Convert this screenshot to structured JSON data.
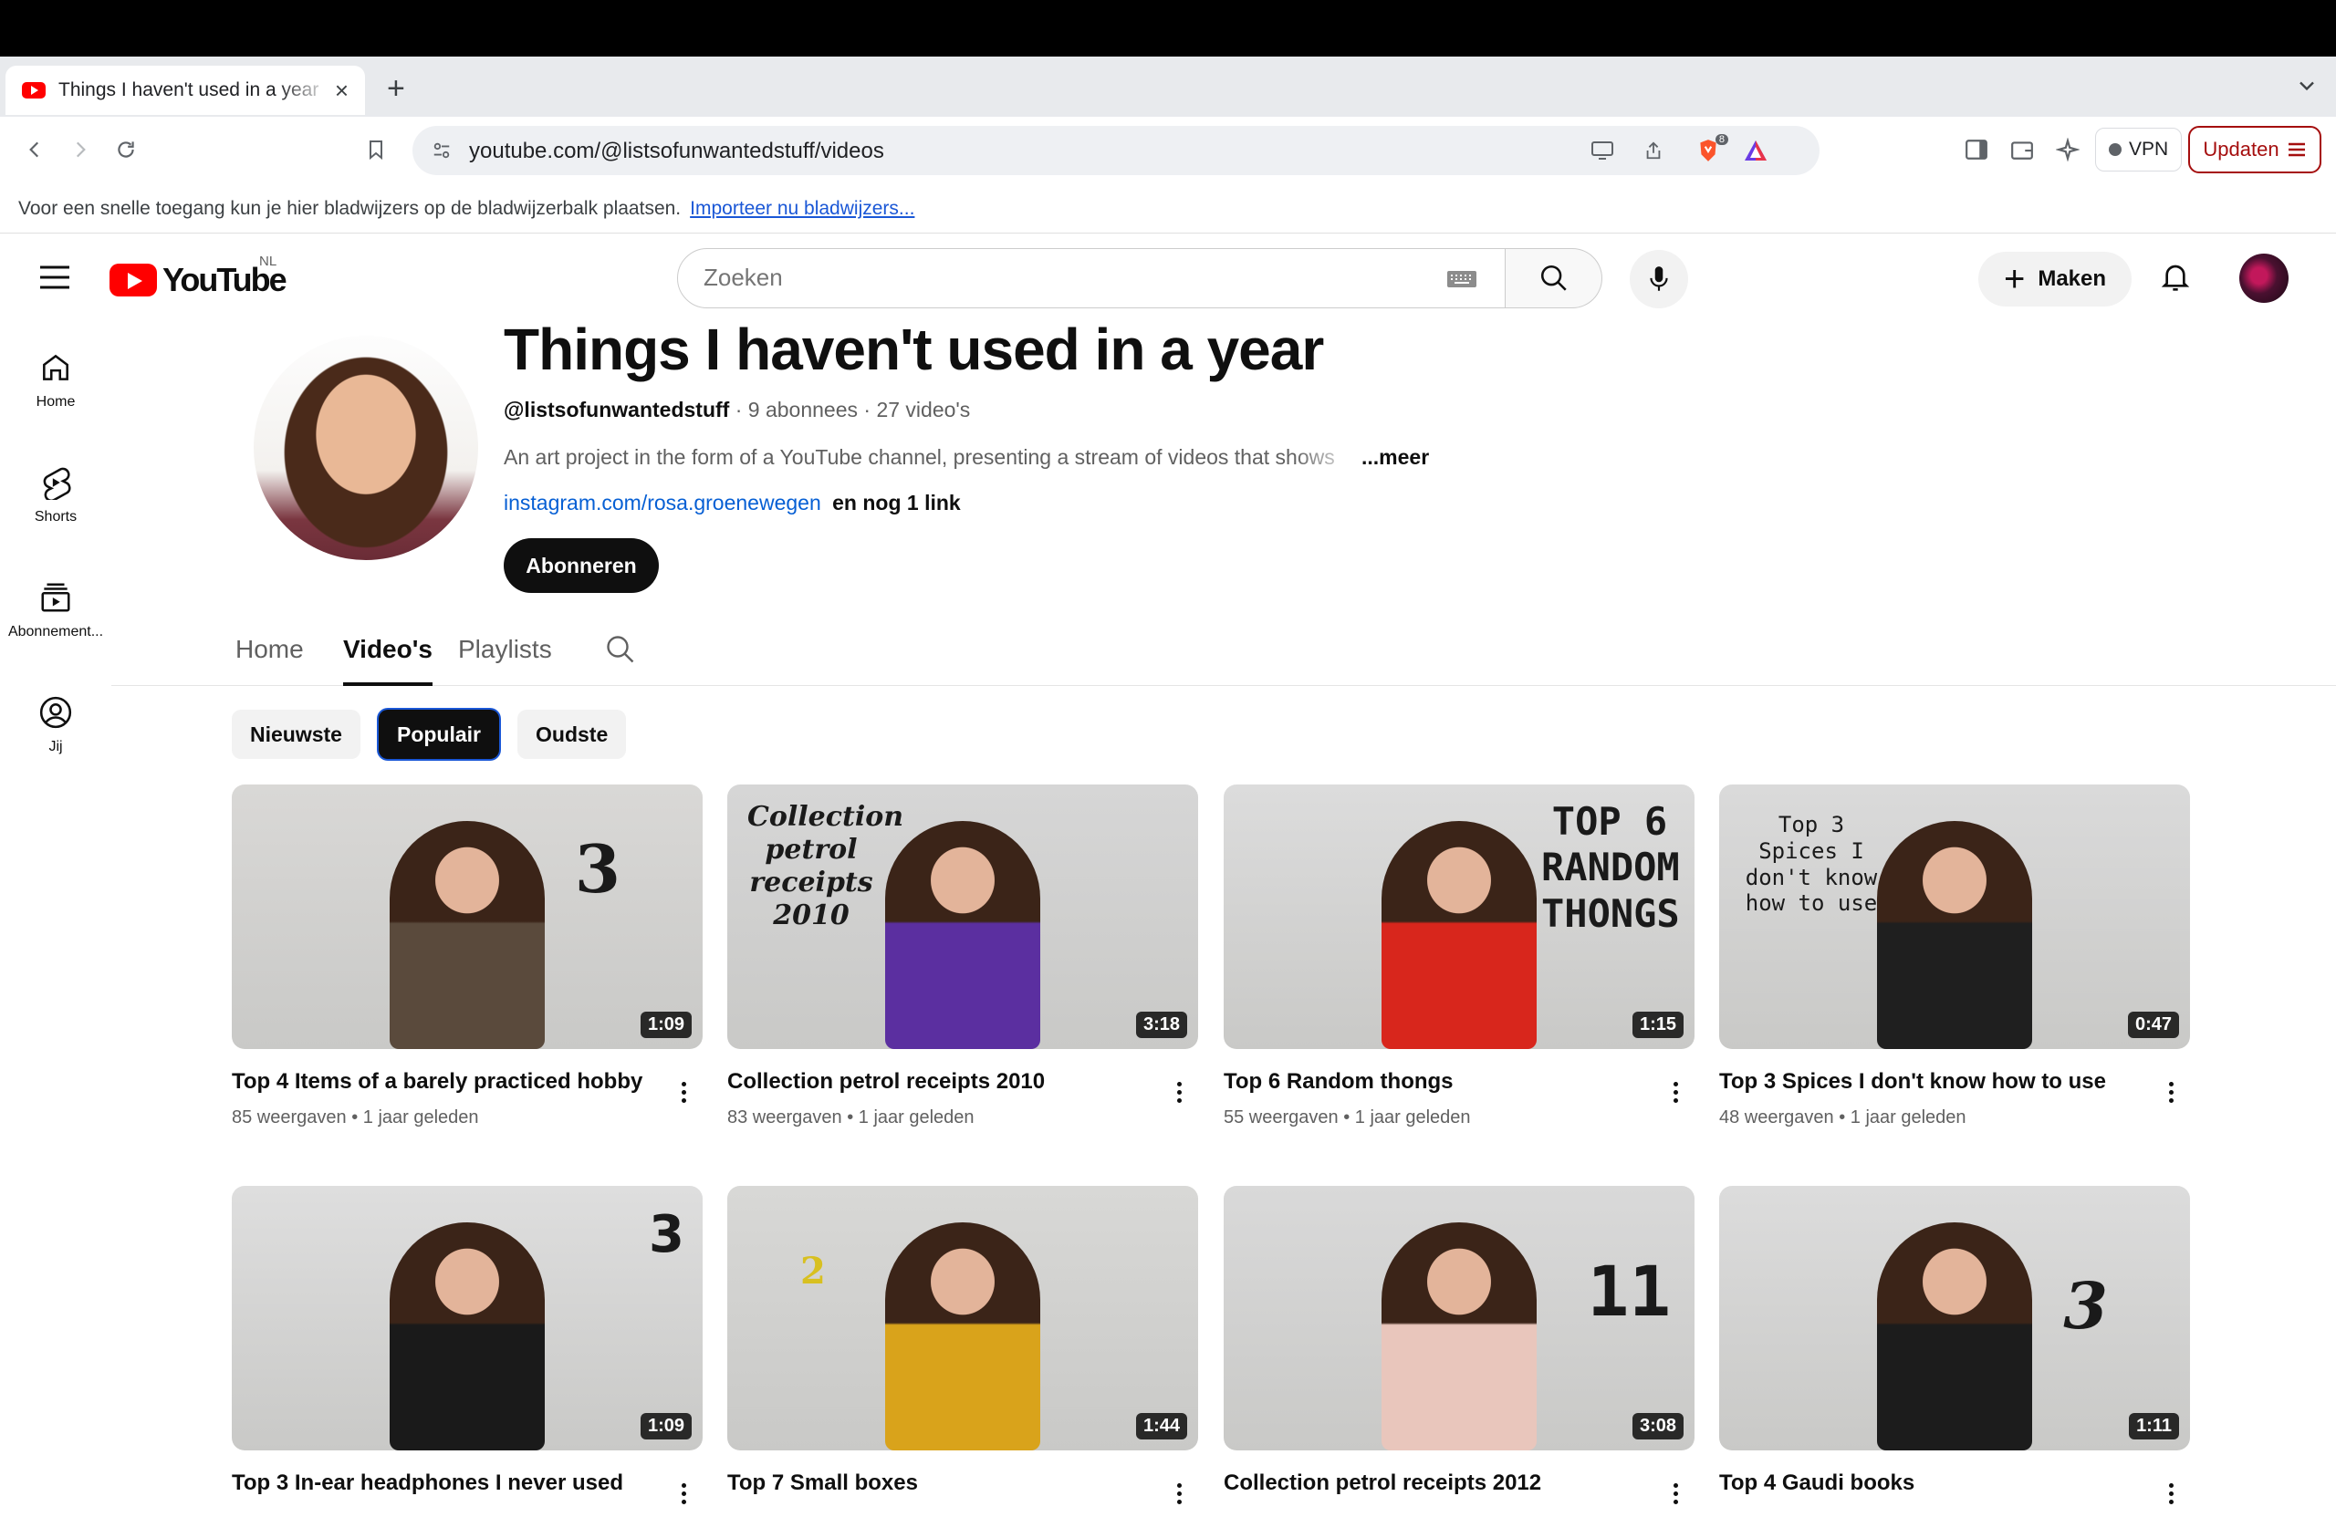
{
  "browser": {
    "tab_title": "Things I haven't used in a year",
    "new_tab_icon": "plus-icon",
    "url": "youtube.com/@listsofunwantedstuff/videos",
    "brave_badge": "8",
    "vpn_label": "VPN",
    "update_label": "Updaten",
    "bookmarks_message": "Voor een snelle toegang kun je hier bladwijzers op de bladwijzerbalk plaatsen.",
    "bookmarks_import_link": "Importeer nu bladwijzers..."
  },
  "masthead": {
    "logo_text": "YouTube",
    "region": "NL",
    "search_placeholder": "Zoeken",
    "create_label": "Maken"
  },
  "guide": {
    "items": [
      {
        "label": "Home",
        "icon": "home-icon"
      },
      {
        "label": "Shorts",
        "icon": "shorts-icon"
      },
      {
        "label": "Abonnement...",
        "icon": "subscriptions-icon"
      },
      {
        "label": "Jij",
        "icon": "you-icon"
      }
    ]
  },
  "channel": {
    "title": "Things I haven't used in a year",
    "handle": "@listsofunwantedstuff",
    "subscribers": "9 abonnees",
    "video_count": "27 video's",
    "description": "An art project in the form of a YouTube channel, presenting a stream of videos that shows",
    "more_label": "...meer",
    "link": "instagram.com/rosa.groenewegen",
    "more_links": "en nog 1 link",
    "subscribe_label": "Abonneren"
  },
  "channel_tabs": [
    "Home",
    "Video's",
    "Playlists"
  ],
  "active_tab": "Video's",
  "filter_chips": [
    "Nieuwste",
    "Populair",
    "Oudste"
  ],
  "active_chip": "Populair",
  "videos": [
    {
      "title": "Top 4 Items of a barely practiced hobby",
      "duration": "1:09",
      "views": "85 weergaven",
      "age": "1 jaar geleden",
      "overlay": "3",
      "bg": "#d9d8d6",
      "shirt": "#5a4a3c"
    },
    {
      "title": "Collection petrol receipts 2010",
      "duration": "3:18",
      "views": "83 weergaven",
      "age": "1 jaar geleden",
      "overlay": "Collection petrol receipts 2010",
      "bg": "#d6d6d6",
      "shirt": "#5b2fa0"
    },
    {
      "title": "Top 6 Random thongs",
      "duration": "1:15",
      "views": "55 weergaven",
      "age": "1 jaar geleden",
      "overlay": "TOP 6 RANDOM THONGS",
      "bg": "#dcdcdc",
      "shirt": "#d8261c"
    },
    {
      "title": "Top 3 Spices I don't know how to use",
      "duration": "0:47",
      "views": "48 weergaven",
      "age": "1 jaar geleden",
      "overlay": "Top 3 Spices I don't know how to use",
      "bg": "#dadada",
      "shirt": "#1f1f1f"
    },
    {
      "title": "Top 3 In-ear headphones I never used",
      "duration": "1:09",
      "views": "",
      "age": "",
      "overlay": "3",
      "bg": "#dedede",
      "shirt": "#1a1a1a"
    },
    {
      "title": "Top 7 Small boxes",
      "duration": "1:44",
      "views": "",
      "age": "",
      "overlay": "2",
      "bg": "#d8d8d6",
      "shirt": "#d9a31b"
    },
    {
      "title": "Collection petrol receipts 2012",
      "duration": "3:08",
      "views": "",
      "age": "",
      "overlay": "11",
      "bg": "#d9d9d9",
      "shirt": "#e9c6bc"
    },
    {
      "title": "Top 4 Gaudi books",
      "duration": "1:11",
      "views": "",
      "age": "",
      "overlay": "3",
      "bg": "#dcdcdc",
      "shirt": "#1c1c1c"
    }
  ]
}
